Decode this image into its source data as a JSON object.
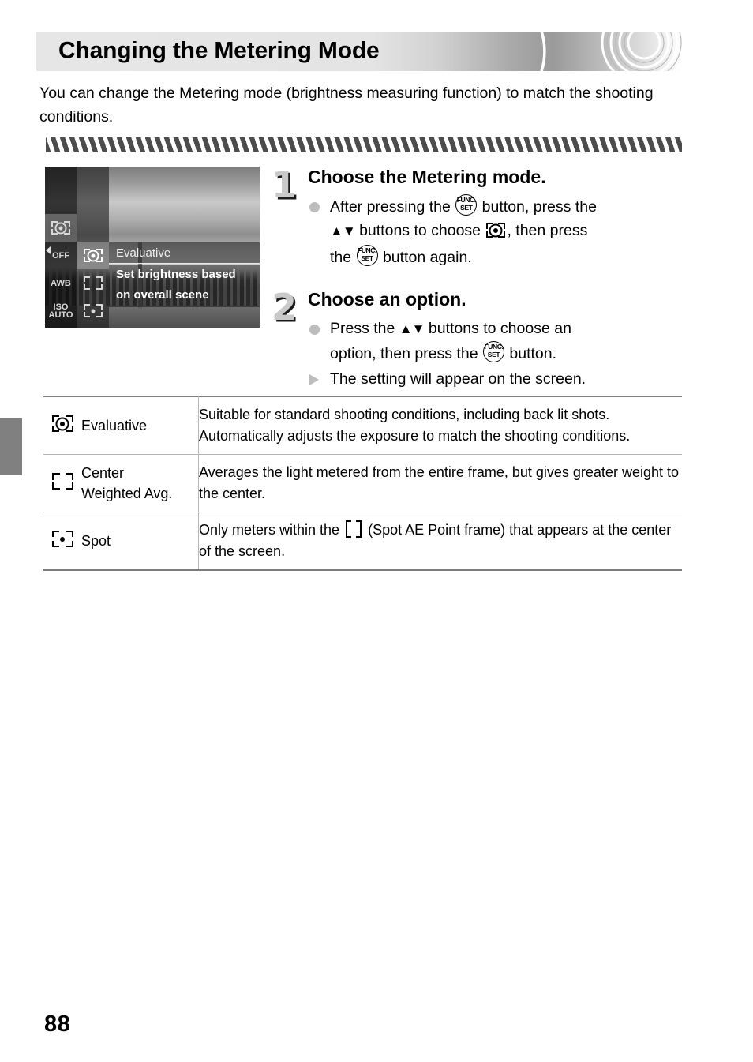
{
  "page": {
    "number": "88",
    "side_tab": "chapter-tab"
  },
  "header": {
    "title": "Changing the Metering Mode"
  },
  "intro": {
    "text": "You can change the Metering mode (brightness measuring function) to match the shooting conditions."
  },
  "camera_screen": {
    "left_column": [
      {
        "icon": "metering-mode-icon",
        "label": ""
      },
      {
        "icon": "flash-off-icon",
        "label": "OFF"
      },
      {
        "icon": "white-balance-auto-icon",
        "label": "AWB"
      },
      {
        "icon": "iso-auto-icon",
        "label": "ISO AUTO"
      }
    ],
    "options_column": [
      {
        "icon": "evaluative-icon",
        "selected": true
      },
      {
        "icon": "center-weighted-icon",
        "selected": false
      },
      {
        "icon": "spot-icon",
        "selected": false
      }
    ],
    "selected_label": "Evaluative",
    "description_line1": "Set brightness based",
    "description_line2": "on overall scene"
  },
  "steps": [
    {
      "number": "1",
      "heading": "Choose the Metering mode.",
      "lines": [
        {
          "marker": "dot",
          "parts": [
            {
              "type": "text",
              "value": "After pressing the "
            },
            {
              "type": "icon",
              "value": "func-set-button-icon"
            },
            {
              "type": "text",
              "value": " button, press the "
            },
            {
              "type": "icon",
              "value": "up-down-buttons-icon"
            },
            {
              "type": "text",
              "value": " buttons to choose "
            },
            {
              "type": "icon",
              "value": "evaluative-metering-icon"
            },
            {
              "type": "text",
              "value": ", then press the "
            },
            {
              "type": "icon",
              "value": "func-set-button-icon"
            },
            {
              "type": "text",
              "value": " button again."
            }
          ],
          "plain": "After pressing the FUNC./SET button, press the up/down buttons to choose the metering icon, then press the FUNC./SET button again."
        }
      ]
    },
    {
      "number": "2",
      "heading": "Choose an option.",
      "lines": [
        {
          "marker": "dot",
          "plain": "Press the up/down buttons to choose an option, then press the FUNC./SET button."
        },
        {
          "marker": "triangle",
          "plain": "The setting will appear on the screen."
        }
      ]
    }
  ],
  "step_text": {
    "s1_a": "After pressing the ",
    "s1_b": " button, press the ",
    "s1_c": " buttons to choose ",
    "s1_d": ", then press",
    "s1_e": "the ",
    "s1_f": " button again.",
    "s2_a": "Press the ",
    "s2_b": " buttons to choose an",
    "s2_c": "option, then press the ",
    "s2_d": " button.",
    "s2_e": "The setting will appear on the screen."
  },
  "func_set_icon": {
    "top": "FUNC.",
    "bottom": "SET"
  },
  "up_down_glyph": "▲▼",
  "options_table": {
    "rows": [
      {
        "icon": "evaluative-metering-icon",
        "name": "Evaluative",
        "name_line2": "",
        "description": "Suitable for standard shooting conditions, including back lit shots. Automatically adjusts the exposure to match the shooting conditions."
      },
      {
        "icon": "center-weighted-average-metering-icon",
        "name": "Center",
        "name_line2": "Weighted Avg.",
        "description": "Averages the light metered from the entire frame, but gives greater weight to the center."
      },
      {
        "icon": "spot-metering-icon",
        "name": "Spot",
        "name_line2": "",
        "description_before": "Only meters within the ",
        "description_after": " (Spot AE Point frame) that appears at the center of the screen.",
        "description": "Only meters within the [ ] (Spot AE Point frame) that appears at the center of the screen."
      }
    ]
  },
  "colors": {
    "banner_light": "#e6e6e6",
    "banner_dark": "#9a9a9a",
    "hatch": "#4c4c4c",
    "step_number": "#c9c9c9",
    "marker": "#bdbdbd",
    "rule": "#b5b5b5",
    "side_tab": "#808080"
  }
}
